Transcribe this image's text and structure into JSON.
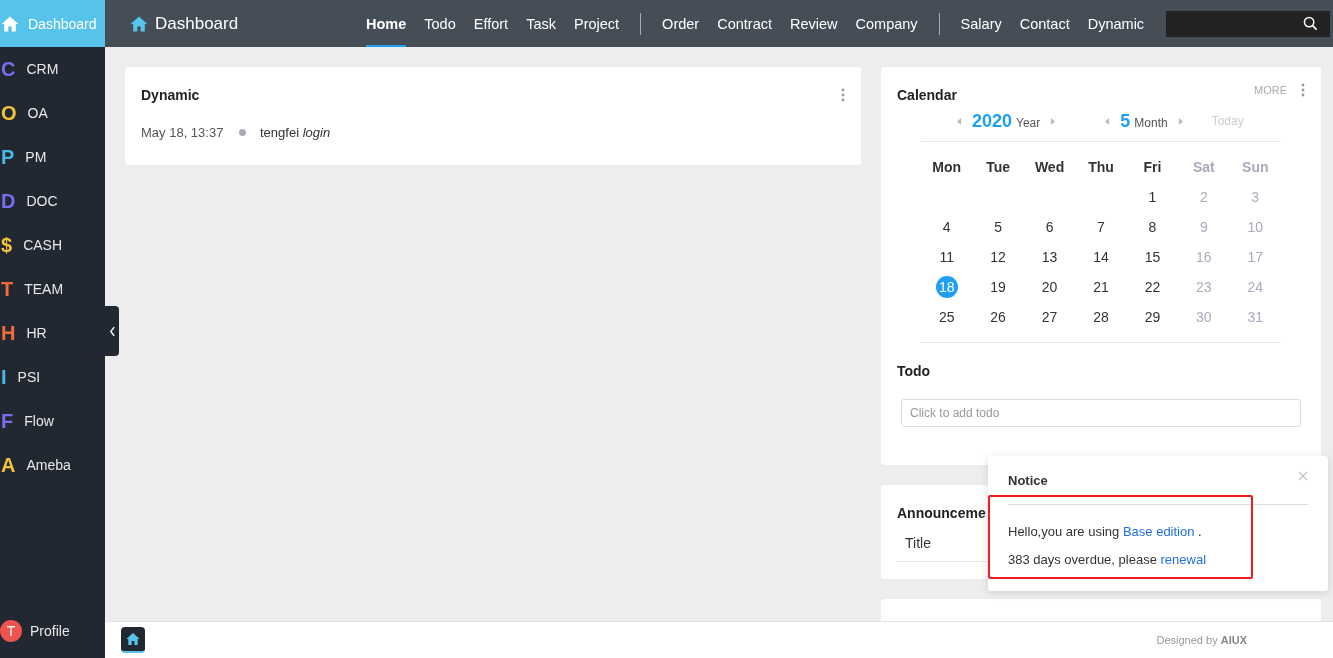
{
  "sidebar": {
    "brand": {
      "label": "Dashboard",
      "selected": true
    },
    "items": [
      {
        "letter": "C",
        "label": "CRM",
        "color": "#7b6cf0",
        "selected": false
      },
      {
        "letter": "O",
        "label": "OA",
        "color": "#f5c33b",
        "selected": false
      },
      {
        "letter": "P",
        "label": "PM",
        "color": "#49b6e8",
        "selected": false
      },
      {
        "letter": "D",
        "label": "DOC",
        "color": "#7b6cf0",
        "selected": false
      },
      {
        "letter": "$",
        "label": "CASH",
        "color": "#f5c33b",
        "selected": false
      },
      {
        "letter": "T",
        "label": "TEAM",
        "color": "#f26b3a",
        "selected": false
      },
      {
        "letter": "H",
        "label": "HR",
        "color": "#f26b3a",
        "selected": false
      },
      {
        "letter": "I",
        "label": "PSI",
        "color": "#49b6e8",
        "selected": false
      },
      {
        "letter": "F",
        "label": "Flow",
        "color": "#7b6cf0",
        "selected": false
      },
      {
        "letter": "A",
        "label": "Ameba",
        "color": "#f5c33b",
        "selected": false
      }
    ],
    "profile": {
      "initial": "T",
      "label": "Profile"
    }
  },
  "header": {
    "title": "Dashboard",
    "nav_groups": [
      [
        {
          "label": "Home",
          "selected": true
        },
        {
          "label": "Todo",
          "selected": false
        },
        {
          "label": "Effort",
          "selected": false
        },
        {
          "label": "Task",
          "selected": false
        },
        {
          "label": "Project",
          "selected": false
        }
      ],
      [
        {
          "label": "Order",
          "selected": false
        },
        {
          "label": "Contract",
          "selected": false
        },
        {
          "label": "Review",
          "selected": false
        },
        {
          "label": "Company",
          "selected": false
        }
      ],
      [
        {
          "label": "Salary",
          "selected": false
        },
        {
          "label": "Contact",
          "selected": false
        },
        {
          "label": "Dynamic",
          "selected": false
        }
      ]
    ]
  },
  "dynamic": {
    "title": "Dynamic",
    "entries": [
      {
        "time": "May 18, 13:37",
        "text": "tengfei *login*"
      }
    ]
  },
  "calendar": {
    "title": "Calendar",
    "more": "MORE",
    "year": "2020",
    "year_label": "Year",
    "month": "5",
    "month_label": "Month",
    "today": "Today",
    "weekdays": [
      {
        "label": "Mon",
        "weekend": false
      },
      {
        "label": "Tue",
        "weekend": false
      },
      {
        "label": "Wed",
        "weekend": false
      },
      {
        "label": "Thu",
        "weekend": false
      },
      {
        "label": "Fri",
        "weekend": false
      },
      {
        "label": "Sat",
        "weekend": true
      },
      {
        "label": "Sun",
        "weekend": true
      }
    ],
    "weeks": [
      [
        {
          "day": "1",
          "selected": false
        },
        {
          "day": "2",
          "selected": false
        },
        {
          "day": "3",
          "selected": false
        }
      ],
      [
        {
          "day": "4",
          "selected": false
        },
        {
          "day": "5",
          "selected": false
        },
        {
          "day": "6",
          "selected": false
        },
        {
          "day": "7",
          "selected": false
        },
        {
          "day": "8",
          "selected": false
        },
        {
          "day": "9",
          "selected": false
        },
        {
          "day": "10",
          "selected": false
        }
      ],
      [
        {
          "day": "11",
          "selected": false
        },
        {
          "day": "12",
          "selected": false
        },
        {
          "day": "13",
          "selected": false
        },
        {
          "day": "14",
          "selected": false
        },
        {
          "day": "15",
          "selected": false
        },
        {
          "day": "16",
          "selected": false
        },
        {
          "day": "17",
          "selected": false
        }
      ],
      [
        {
          "day": "18",
          "selected": true
        },
        {
          "day": "19",
          "selected": false
        },
        {
          "day": "20",
          "selected": false
        },
        {
          "day": "21",
          "selected": false
        },
        {
          "day": "22",
          "selected": false
        },
        {
          "day": "23",
          "selected": false
        },
        {
          "day": "24",
          "selected": false
        }
      ],
      [
        {
          "day": "25",
          "selected": false
        },
        {
          "day": "26",
          "selected": false
        },
        {
          "day": "27",
          "selected": false
        },
        {
          "day": "28",
          "selected": false
        },
        {
          "day": "29",
          "selected": false
        },
        {
          "day": "30",
          "selected": false
        },
        {
          "day": "31",
          "selected": false
        }
      ]
    ]
  },
  "todo": {
    "title": "Todo",
    "placeholder": "Click to add todo"
  },
  "announcement": {
    "title": "Announceme",
    "columns": [
      "Title"
    ]
  },
  "notice": {
    "title": "Notice",
    "lines": [
      {
        "text": "Hello,you are using ",
        "link": "Base edition",
        "after": " ."
      },
      {
        "text": "383 days overdue, please ",
        "link": "renewal"
      }
    ]
  },
  "footer": {
    "credit": "Designed by **AIUX**"
  }
}
